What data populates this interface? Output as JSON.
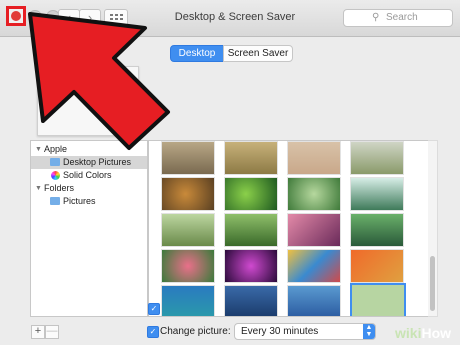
{
  "window": {
    "title": "Desktop & Screen Saver",
    "search_placeholder": "Search"
  },
  "tabs": [
    {
      "label": "Desktop",
      "active": true
    },
    {
      "label": "Screen Saver",
      "active": false
    }
  ],
  "sidebar": {
    "groups": [
      {
        "label": "Apple",
        "items": [
          {
            "label": "Desktop Pictures",
            "selected": true,
            "icon": "folder-icon"
          },
          {
            "label": "Solid Colors",
            "selected": false,
            "icon": "color-wheel-icon"
          }
        ]
      },
      {
        "label": "Folders",
        "items": [
          {
            "label": "Pictures",
            "selected": false,
            "icon": "folder-icon"
          }
        ]
      }
    ]
  },
  "bottom": {
    "add_label": "+",
    "remove_label": "—",
    "change_picture_label": "Change picture:",
    "change_picture_checked": true,
    "interval_value": "Every 30 minutes"
  },
  "watermark": {
    "prefix": "wiki",
    "suffix": "How"
  },
  "colors": {
    "accent": "#3f8ef0",
    "annotation_red": "#e61e23"
  }
}
